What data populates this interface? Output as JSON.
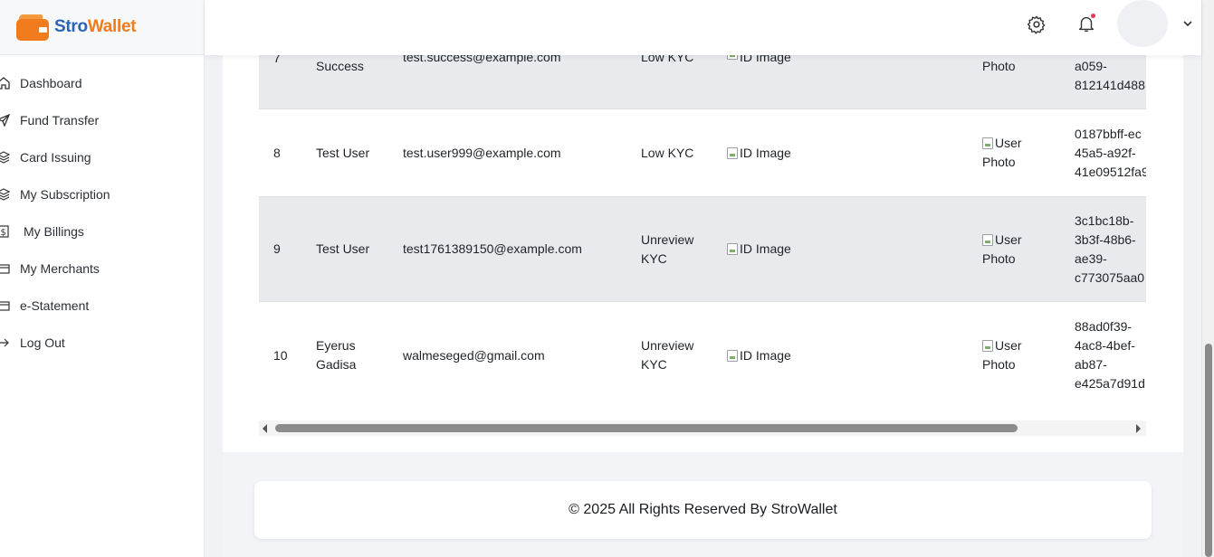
{
  "brand": {
    "part1": "Stro",
    "part2": "Wallet"
  },
  "sidebar": {
    "items": [
      {
        "label": "Dashboard",
        "icon": "home-icon"
      },
      {
        "label": "Fund Transfer",
        "icon": "send-icon"
      },
      {
        "label": "Card Issuing",
        "icon": "layers-icon"
      },
      {
        "label": "My Subscription",
        "icon": "layers-icon"
      },
      {
        "label": "My Billings",
        "icon": "dollar-icon"
      },
      {
        "label": "My Merchants",
        "icon": "store-icon"
      },
      {
        "label": "e-Statement",
        "icon": "statement-icon"
      },
      {
        "label": "Log Out",
        "icon": "logout-icon"
      }
    ]
  },
  "topbar": {
    "gear_icon": "gear-icon",
    "bell_icon": "bell-icon",
    "notification_color": "#e53950"
  },
  "table": {
    "rows": [
      {
        "id": "7",
        "name": [
          "",
          "Success"
        ],
        "email": "test.success@example.com",
        "kyc": [
          "Low KYC"
        ],
        "id_image": "ID Image",
        "photo": [
          "",
          "Photo"
        ],
        "uuid": [
          "",
          "a059-",
          "812141d488"
        ]
      },
      {
        "id": "8",
        "name": [
          "Test User"
        ],
        "email": "test.user999@example.com",
        "kyc": [
          "Low KYC"
        ],
        "id_image": "ID Image",
        "photo": [
          "User",
          "Photo"
        ],
        "uuid": [
          "0187bbff-ec",
          "45a5-a92f-",
          "41e09512fa9"
        ]
      },
      {
        "id": "9",
        "name": [
          "Test User"
        ],
        "email": "test1761389150@example.com",
        "kyc": [
          "Unreview",
          "KYC"
        ],
        "id_image": "ID Image",
        "photo": [
          "User",
          "Photo"
        ],
        "uuid": [
          "3c1bc18b-",
          "3b3f-48b6-",
          "ae39-",
          "c773075aa0"
        ]
      },
      {
        "id": "10",
        "name": [
          "Eyerus",
          "Gadisa"
        ],
        "email": "walmeseged@gmail.com",
        "kyc": [
          "Unreview",
          "KYC"
        ],
        "id_image": "ID Image",
        "photo": [
          "User",
          "Photo"
        ],
        "uuid": [
          "88ad0f39-",
          "4ac8-4bef-",
          "ab87-",
          "e425a7d91d"
        ]
      }
    ]
  },
  "footer": {
    "text": "© 2025 All Rights Reserved By StroWallet"
  },
  "colors": {
    "brand_blue": "#2a63b6",
    "brand_orange": "#f07c1d"
  }
}
